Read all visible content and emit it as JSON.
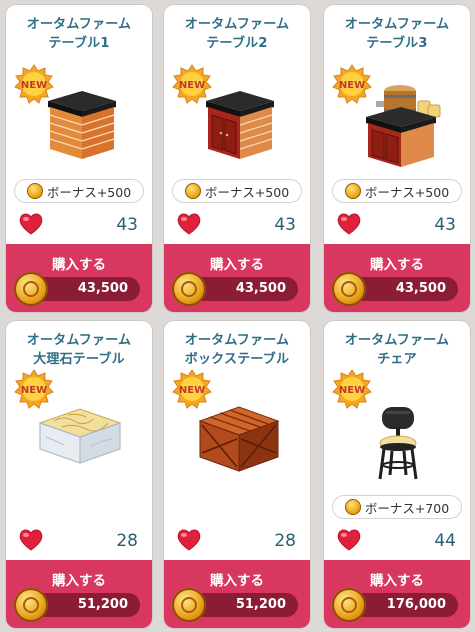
{
  "cards": [
    {
      "title_line1": "オータムファーム",
      "title_line2": "テーブル1",
      "badge": "NEW",
      "bonus": "ボーナス+500",
      "likes": "43",
      "buy_label": "購入する",
      "price": "43,500"
    },
    {
      "title_line1": "オータムファーム",
      "title_line2": "テーブル2",
      "badge": "NEW",
      "bonus": "ボーナス+500",
      "likes": "43",
      "buy_label": "購入する",
      "price": "43,500"
    },
    {
      "title_line1": "オータムファーム",
      "title_line2": "テーブル3",
      "badge": "NEW",
      "bonus": "ボーナス+500",
      "likes": "43",
      "buy_label": "購入する",
      "price": "43,500"
    },
    {
      "title_line1": "オータムファーム",
      "title_line2": "大理石テーブル",
      "badge": "NEW",
      "bonus": "",
      "likes": "28",
      "buy_label": "購入する",
      "price": "51,200"
    },
    {
      "title_line1": "オータムファーム",
      "title_line2": "ボックステーブル",
      "badge": "NEW",
      "bonus": "",
      "likes": "28",
      "buy_label": "購入する",
      "price": "51,200"
    },
    {
      "title_line1": "オータムファーム",
      "title_line2": "チェア",
      "badge": "NEW",
      "bonus": "ボーナス+700",
      "likes": "44",
      "buy_label": "購入する",
      "price": "176,000"
    }
  ],
  "colors": {
    "buy_bg": "#d8375f",
    "price_pill": "#8a1d35",
    "title": "#2f6e86",
    "heart": "#e3203c"
  },
  "icons": [
    "new-badge-icon",
    "heart-icon",
    "coin-icon"
  ]
}
